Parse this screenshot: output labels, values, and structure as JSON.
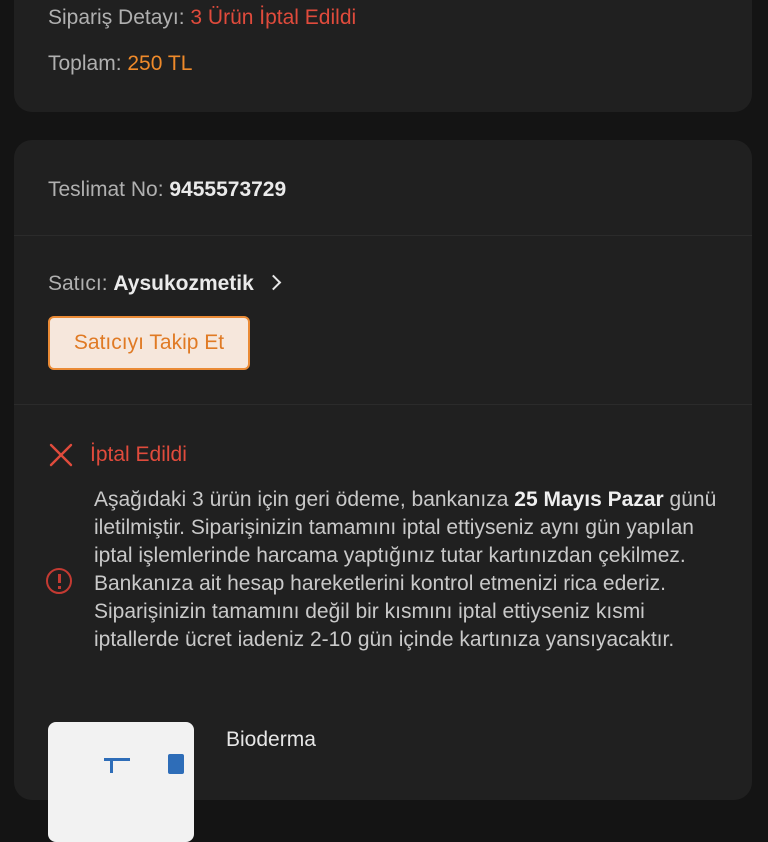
{
  "order_summary": {
    "detail_label": "Sipariş Detayı:",
    "detail_value": "3 Ürün İptal Edildi",
    "total_label": "Toplam:",
    "total_value": "250 TL"
  },
  "delivery": {
    "label": "Teslimat No:",
    "number": "9455573729"
  },
  "seller": {
    "label": "Satıcı:",
    "name": "Aysukozmetik",
    "follow_button": "Satıcıyı Takip Et"
  },
  "status": {
    "text": "İptal Edildi"
  },
  "refund_notice": {
    "text_before": "Aşağıdaki 3 ürün için geri ödeme, bankanıza ",
    "highlight": "25 Mayıs Pazar",
    "text_after": " günü iletilmiştir. Siparişinizin tamamını iptal ettiyseniz aynı gün yapılan iptal işlemlerinde harcama yaptığınız tutar kartınızdan çekilmez. Bankanıza ait hesap hareketlerini kontrol etmenizi rica ederiz. Siparişinizin tamamını değil bir kısmını iptal ettiyseniz kısmi iptallerde ücret iadeniz 2-10 gün içinde kartınıza yansıyacaktır."
  },
  "product": {
    "brand": "Bioderma"
  },
  "colors": {
    "background": "#141414",
    "card": "#202020",
    "cancel_red": "#e04b3c",
    "accent_orange": "#ef8a2a"
  }
}
